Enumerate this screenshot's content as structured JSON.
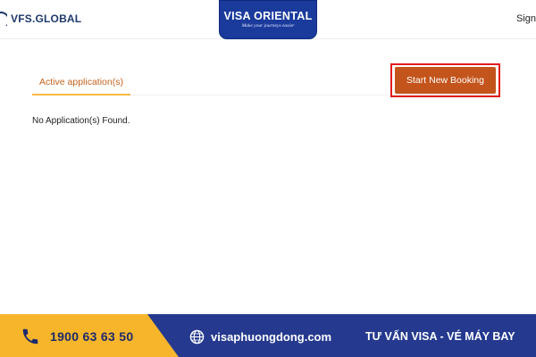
{
  "header": {
    "logo_text": "VFS.GLOBAL",
    "brand_title": "VISA ORIENTAL",
    "brand_tagline": "Make your journeys easier",
    "sign_label": "Sign"
  },
  "tabs": {
    "active_label": "Active application(s)"
  },
  "actions": {
    "start_booking_label": "Start New Booking"
  },
  "content": {
    "empty_message": "No Application(s) Found."
  },
  "footer": {
    "phone": "1900 63 63 50",
    "website": "visaphuongdong.com",
    "slogan": "TƯ VẤN VISA - VÉ MÁY BAY"
  },
  "icons": {
    "phone": "phone-icon",
    "globe": "globe-icon"
  },
  "colors": {
    "accent_orange": "#c3541b",
    "tab_text": "#c4641f",
    "tab_underline": "#f5b942",
    "highlight_red": "#e21b1b",
    "brand_blue": "#1a3a9c",
    "footer_blue": "#253a8f",
    "footer_yellow": "#f7b52c"
  }
}
